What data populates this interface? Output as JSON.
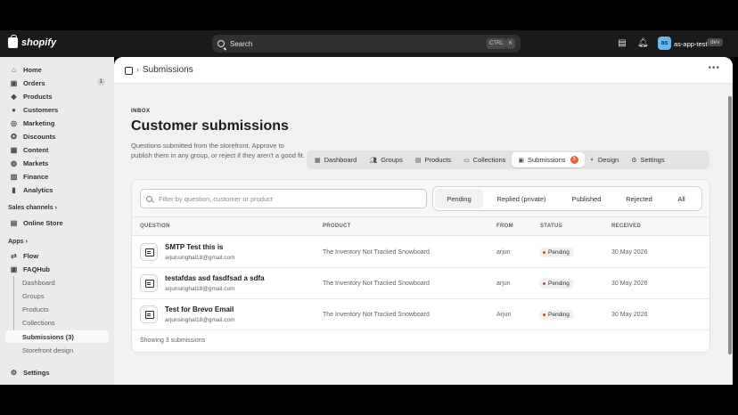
{
  "topbar": {
    "brand": "shopify",
    "search_placeholder": "Search",
    "shortcut_ctrl": "CTRL",
    "shortcut_key": "K",
    "store_initials": "as",
    "store_name": "as-app-test",
    "env_badge": "dev"
  },
  "sidebar": {
    "items": [
      {
        "label": "Home",
        "icon": "home-icon"
      },
      {
        "label": "Orders",
        "icon": "orders-icon",
        "count": "1"
      },
      {
        "label": "Products",
        "icon": "tag-icon"
      },
      {
        "label": "Customers",
        "icon": "person-icon"
      },
      {
        "label": "Marketing",
        "icon": "target-icon"
      },
      {
        "label": "Discounts",
        "icon": "discount-icon"
      },
      {
        "label": "Content",
        "icon": "content-icon"
      },
      {
        "label": "Markets",
        "icon": "globe-icon"
      },
      {
        "label": "Finance",
        "icon": "bank-icon"
      },
      {
        "label": "Analytics",
        "icon": "chart-icon"
      }
    ],
    "sales_channels_heading": "Sales channels",
    "online_store": "Online Store",
    "apps_heading": "Apps",
    "flow": "Flow",
    "faqhub": "FAQHub",
    "sub_items": [
      "Dashboard",
      "Groups",
      "Products",
      "Collections",
      "Submissions (3)",
      "Storefront design"
    ],
    "settings": "Settings"
  },
  "titlebar": {
    "title": "Submissions"
  },
  "page": {
    "eyebrow": "INBOX",
    "heading": "Customer submissions",
    "description": "Questions submitted from the storefront. Approve to publish them in any group, or reject if they aren't a good fit."
  },
  "tabs": [
    {
      "label": "Dashboard",
      "icon": "grid-icon"
    },
    {
      "label": "Groups",
      "icon": "people-icon"
    },
    {
      "label": "Products",
      "icon": "box-icon"
    },
    {
      "label": "Collections",
      "icon": "folder-icon"
    },
    {
      "label": "Submissions",
      "icon": "inbox-icon",
      "badge": "3",
      "active": true
    },
    {
      "label": "Design",
      "icon": "palette-icon"
    },
    {
      "label": "Settings",
      "icon": "gear-icon"
    }
  ],
  "filter": {
    "placeholder": "Filter by question, customer or product",
    "segments": [
      "Pending",
      "Replied (private)",
      "Published",
      "Rejected",
      "All"
    ],
    "selected": "Pending"
  },
  "table": {
    "headers": [
      "QUESTION",
      "PRODUCT",
      "FROM",
      "STATUS",
      "RECEIVED"
    ],
    "rows": [
      {
        "question": "SMTP Test this is",
        "email": "arjunsinghal18@gmail.com",
        "product": "The Inventory Not Tracked Snowboard",
        "from": "arjun",
        "status": "Pending",
        "received": "30 May 2026"
      },
      {
        "question": "testafdas asd fasdfsad a sdfa",
        "email": "arjunsinghal18@gmail.com",
        "product": "The Inventory Not Tracked Snowboard",
        "from": "arjun",
        "status": "Pending",
        "received": "30 May 2026"
      },
      {
        "question": "Test for Brevo Email",
        "email": "arjunsinghal18@gmail.com",
        "product": "The Inventory Not Tracked Snowboard",
        "from": "Arjun",
        "status": "Pending",
        "received": "30 May 2026"
      }
    ],
    "footer": "Showing 3 submissions"
  },
  "colors": {
    "topbar": "#1a1a1a",
    "accent_badge": "#e0663d",
    "pending_dot": "#c4531b"
  }
}
